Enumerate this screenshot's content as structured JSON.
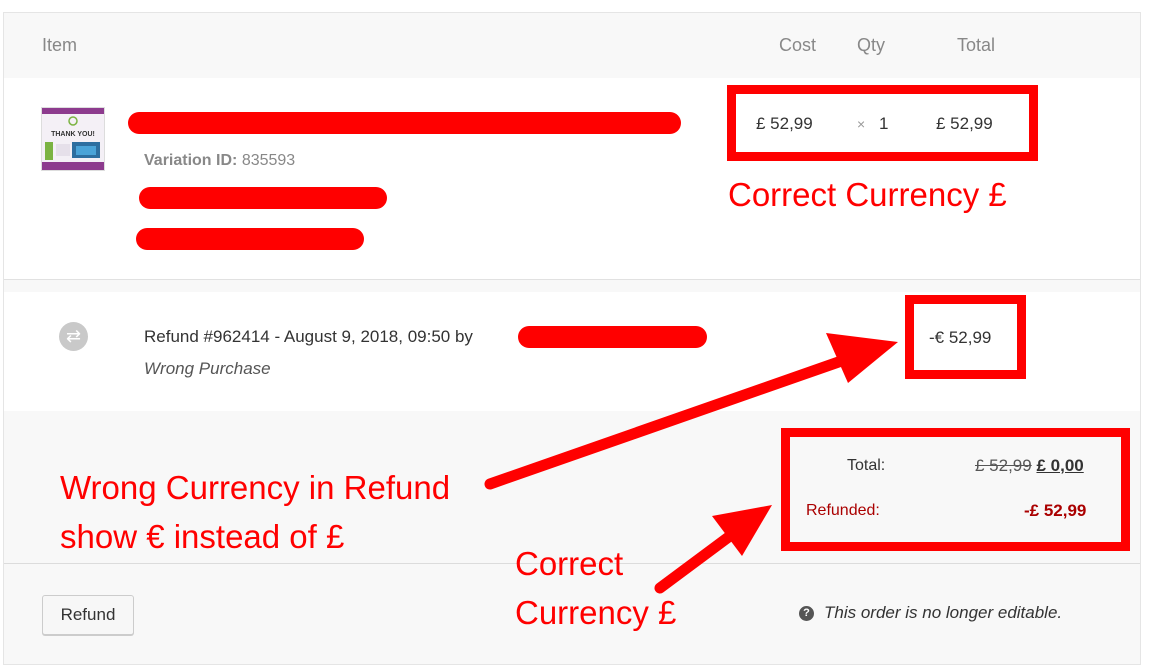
{
  "header": {
    "item": "Item",
    "cost": "Cost",
    "qty": "Qty",
    "total": "Total"
  },
  "line_item": {
    "thumbnail_text": "THANK YOU!",
    "variation_label": "Variation ID:",
    "variation_id": "835593",
    "cost": "£ 52,99",
    "qty_symbol": "×",
    "qty": "1",
    "total": "£ 52,99"
  },
  "refund": {
    "icon": "refund-icon",
    "text": "Refund #962414 - August 9, 2018, 09:50 by",
    "reason": "Wrong Purchase",
    "amount": "-€ 52,99"
  },
  "totals": {
    "total_label": "Total:",
    "total_original": "£ 52,99",
    "total_new": "£ 0,00",
    "refunded_label": "Refunded:",
    "refunded_value": "-£ 52,99"
  },
  "actions": {
    "refund_button": "Refund",
    "not_editable_note": "This order is no longer editable.",
    "info_icon": "question-icon"
  },
  "annotations": {
    "correct_currency_top": "Correct Currency £",
    "wrong_currency_line1": "Wrong Currency in Refund",
    "wrong_currency_line2": "show € instead of £",
    "correct_currency_bottom_line1": "Correct",
    "correct_currency_bottom_line2": "Currency £",
    "annotation_color": "#ff0000"
  }
}
